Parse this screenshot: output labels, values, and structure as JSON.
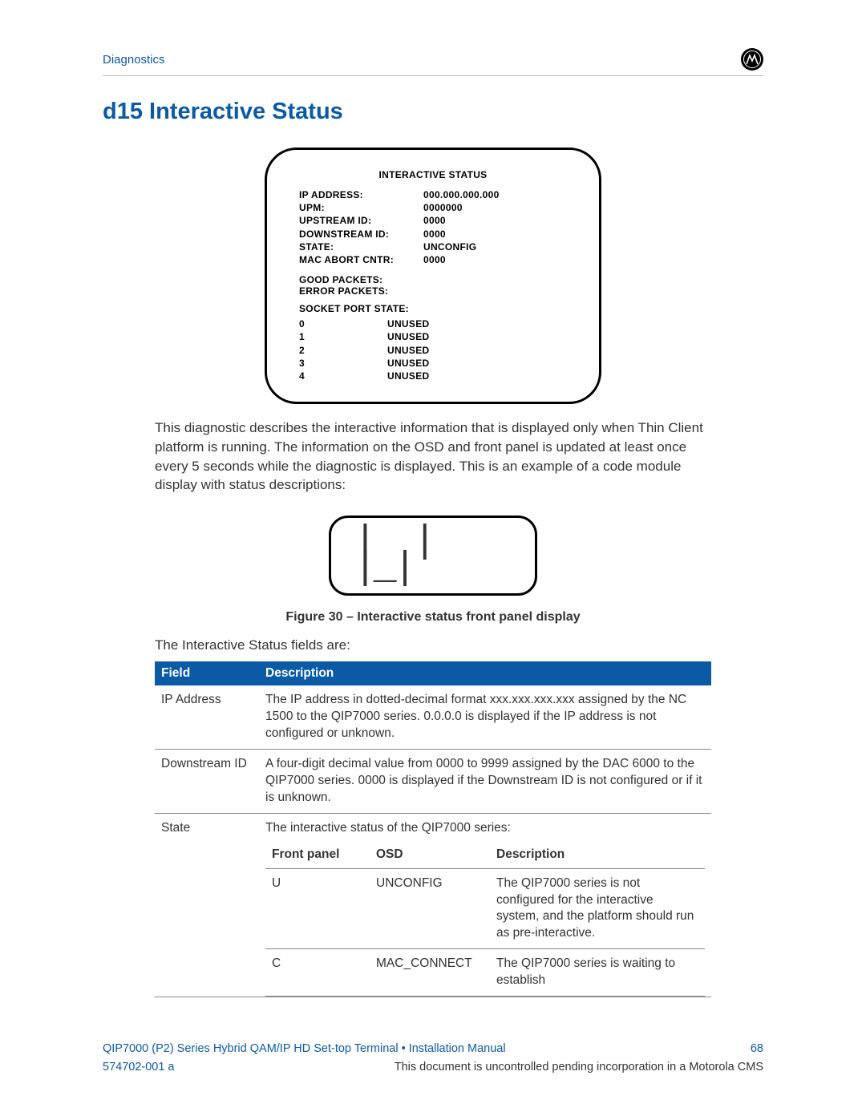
{
  "header": {
    "section": "Diagnostics"
  },
  "title": "d15 Interactive Status",
  "panel": {
    "title": "INTERACTIVE STATUS",
    "rows": [
      {
        "k": "IP ADDRESS:",
        "v": "000.000.000.000"
      },
      {
        "k": "UPM:",
        "v": "0000000"
      },
      {
        "k": "UPSTREAM ID:",
        "v": "0000"
      },
      {
        "k": "DOWNSTREAM ID:",
        "v": "0000"
      },
      {
        "k": "STATE:",
        "v": "UNCONFIG"
      },
      {
        "k": "MAC ABORT CNTR:",
        "v": "0000"
      }
    ],
    "sub": [
      "GOOD PACKETS:",
      "ERROR PACKETS:"
    ],
    "socket_label": "SOCKET PORT STATE:",
    "ports": [
      {
        "k": "0",
        "v": "UNUSED"
      },
      {
        "k": "1",
        "v": "UNUSED"
      },
      {
        "k": "2",
        "v": "UNUSED"
      },
      {
        "k": "3",
        "v": "UNUSED"
      },
      {
        "k": "4",
        "v": "UNUSED"
      }
    ]
  },
  "body_text": "This diagnostic describes the interactive information that is displayed only when Thin Client platform is running. The information on the OSD and front panel is updated at least once every 5 seconds while the diagnostic is displayed. This is an example of a code module display with status descriptions:",
  "caption": "Figure 30 – Interactive status front panel display",
  "intro": "The Interactive Status fields are:",
  "table": {
    "headers": {
      "field": "Field",
      "desc": "Description"
    },
    "rows": {
      "ip": {
        "field": "IP Address",
        "desc": "The IP address in dotted-decimal format xxx.xxx.xxx.xxx assigned by the NC 1500 to the QIP7000 series. 0.0.0.0 is displayed if the IP address is not configured or unknown."
      },
      "down": {
        "field": "Downstream ID",
        "desc": "A four-digit decimal value from 0000 to 9999 assigned by the DAC 6000 to the QIP7000 series. 0000 is displayed if the Downstream ID is not configured or if it is unknown."
      },
      "state": {
        "field": "State",
        "desc": "The interactive status of the QIP7000 series:"
      }
    }
  },
  "state_table": {
    "headers": {
      "fp": "Front panel",
      "osd": "OSD",
      "desc": "Description"
    },
    "rows": {
      "u": {
        "fp": "U",
        "osd": "UNCONFIG",
        "desc": "The QIP7000 series is not configured for the interactive system, and the platform should run as pre-interactive."
      },
      "c": {
        "fp": "C",
        "osd": "MAC_CONNECT",
        "desc": "The QIP7000 series is waiting to establish"
      }
    }
  },
  "footer": {
    "line1_left": "QIP7000 (P2) Series Hybrid QAM/IP HD Set-top Terminal • Installation Manual",
    "line1_right": "68",
    "line2_left": "574702-001 a",
    "line2_right": "This document is uncontrolled pending incorporation in a Motorola CMS"
  }
}
